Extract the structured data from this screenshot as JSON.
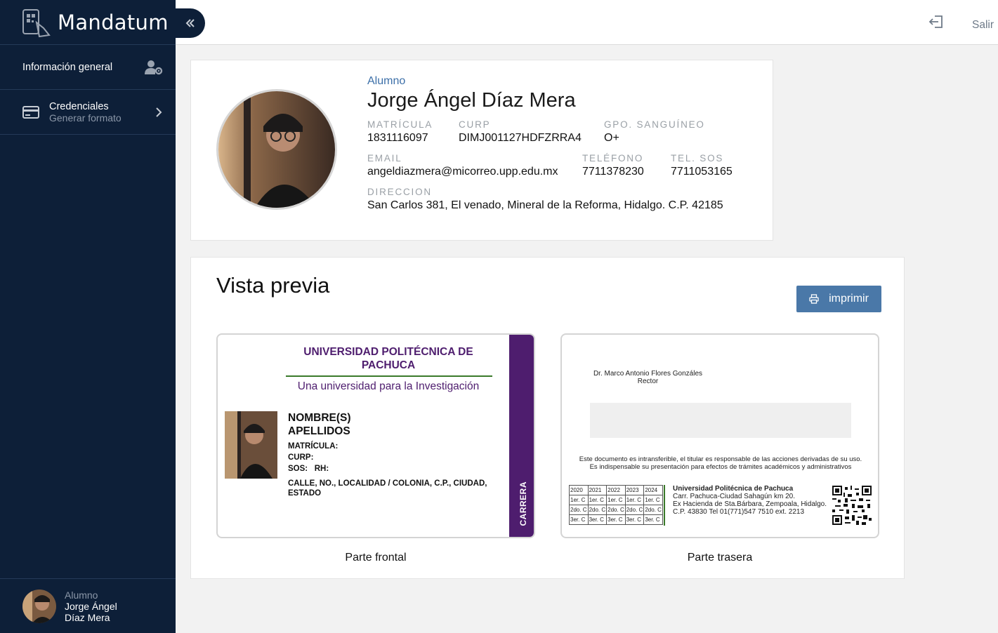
{
  "app": {
    "title": "Mandatum"
  },
  "sidebar": {
    "items": [
      {
        "label": "Información general",
        "icon": "user-gear-icon"
      },
      {
        "label": "Credenciales",
        "sublabel": "Generar formato",
        "icon": "credit-card-icon"
      }
    ],
    "user": {
      "role": "Alumno",
      "name_line1": "Jorge Ángel",
      "name_line2": "Díaz Mera"
    }
  },
  "topbar": {
    "logout_label": "Salir"
  },
  "profile": {
    "role": "Alumno",
    "name": "Jorge Ángel Díaz Mera",
    "matricula_label": "MATRÍCULA",
    "matricula": "1831116097",
    "curp_label": "CURP",
    "curp": "DIMJ001127HDFZRRA4",
    "sangre_label": "GPO. SANGUÍNEO",
    "sangre": "O+",
    "email_label": "EMAIL",
    "email": "angeldiazmera@micorreo.upp.edu.mx",
    "telefono_label": "TELÉFONO",
    "telefono": "7711378230",
    "tel_sos_label": "TEL. SOS",
    "tel_sos": "7711053165",
    "direccion_label": "DIRECCION",
    "direccion": "San Carlos 381, El venado, Mineral de la Reforma, Hidalgo. C.P. 42185"
  },
  "preview": {
    "title": "Vista previa",
    "print_label": "imprimir",
    "front_caption": "Parte frontal",
    "back_caption": "Parte trasera",
    "front": {
      "university_line1": "UNIVERSIDAD POLITÉCNICA DE",
      "university_line2": "PACHUCA",
      "slogan": "Una universidad para la Investigación",
      "names": "NOMBRE(S)",
      "surnames": "APELLIDOS",
      "matricula": "MATRÍCULA:",
      "curp": "CURP:",
      "sos": "SOS:",
      "rh": "RH:",
      "address": "CALLE, NO., LOCALIDAD / COLONIA, C.P., CIUDAD, ESTADO",
      "career": "CARRERA"
    },
    "back": {
      "rector_name": "Dr. Marco Antonio Flores Gonzáles",
      "rector_title": "Rector",
      "disclaimer_1": "Este documento es intransferible, el titular es responsable de las acciones derivadas de su uso.",
      "disclaimer_2": "Es indispensable su presentación para efectos de trámites académicos y administrativos",
      "years": [
        "2020",
        "2021",
        "2022",
        "2023",
        "2024"
      ],
      "semesters": [
        "1er. C",
        "2do. C",
        "3er. C"
      ],
      "univ_name": "Universidad Politécnica de Pachuca",
      "addr_1": "Carr. Pachuca-Ciudad Sahagún km 20.",
      "addr_2": "Ex Hacienda de Sta.Bárbara, Zempoala, Hidalgo.",
      "addr_3": "C.P. 43830 Tel 01(771)547 7510 ext. 2213"
    }
  },
  "colors": {
    "sidebar": "#0d1f38",
    "accent": "#4a78a8",
    "purple": "#4e1d6e",
    "green": "#3a7a2a"
  }
}
